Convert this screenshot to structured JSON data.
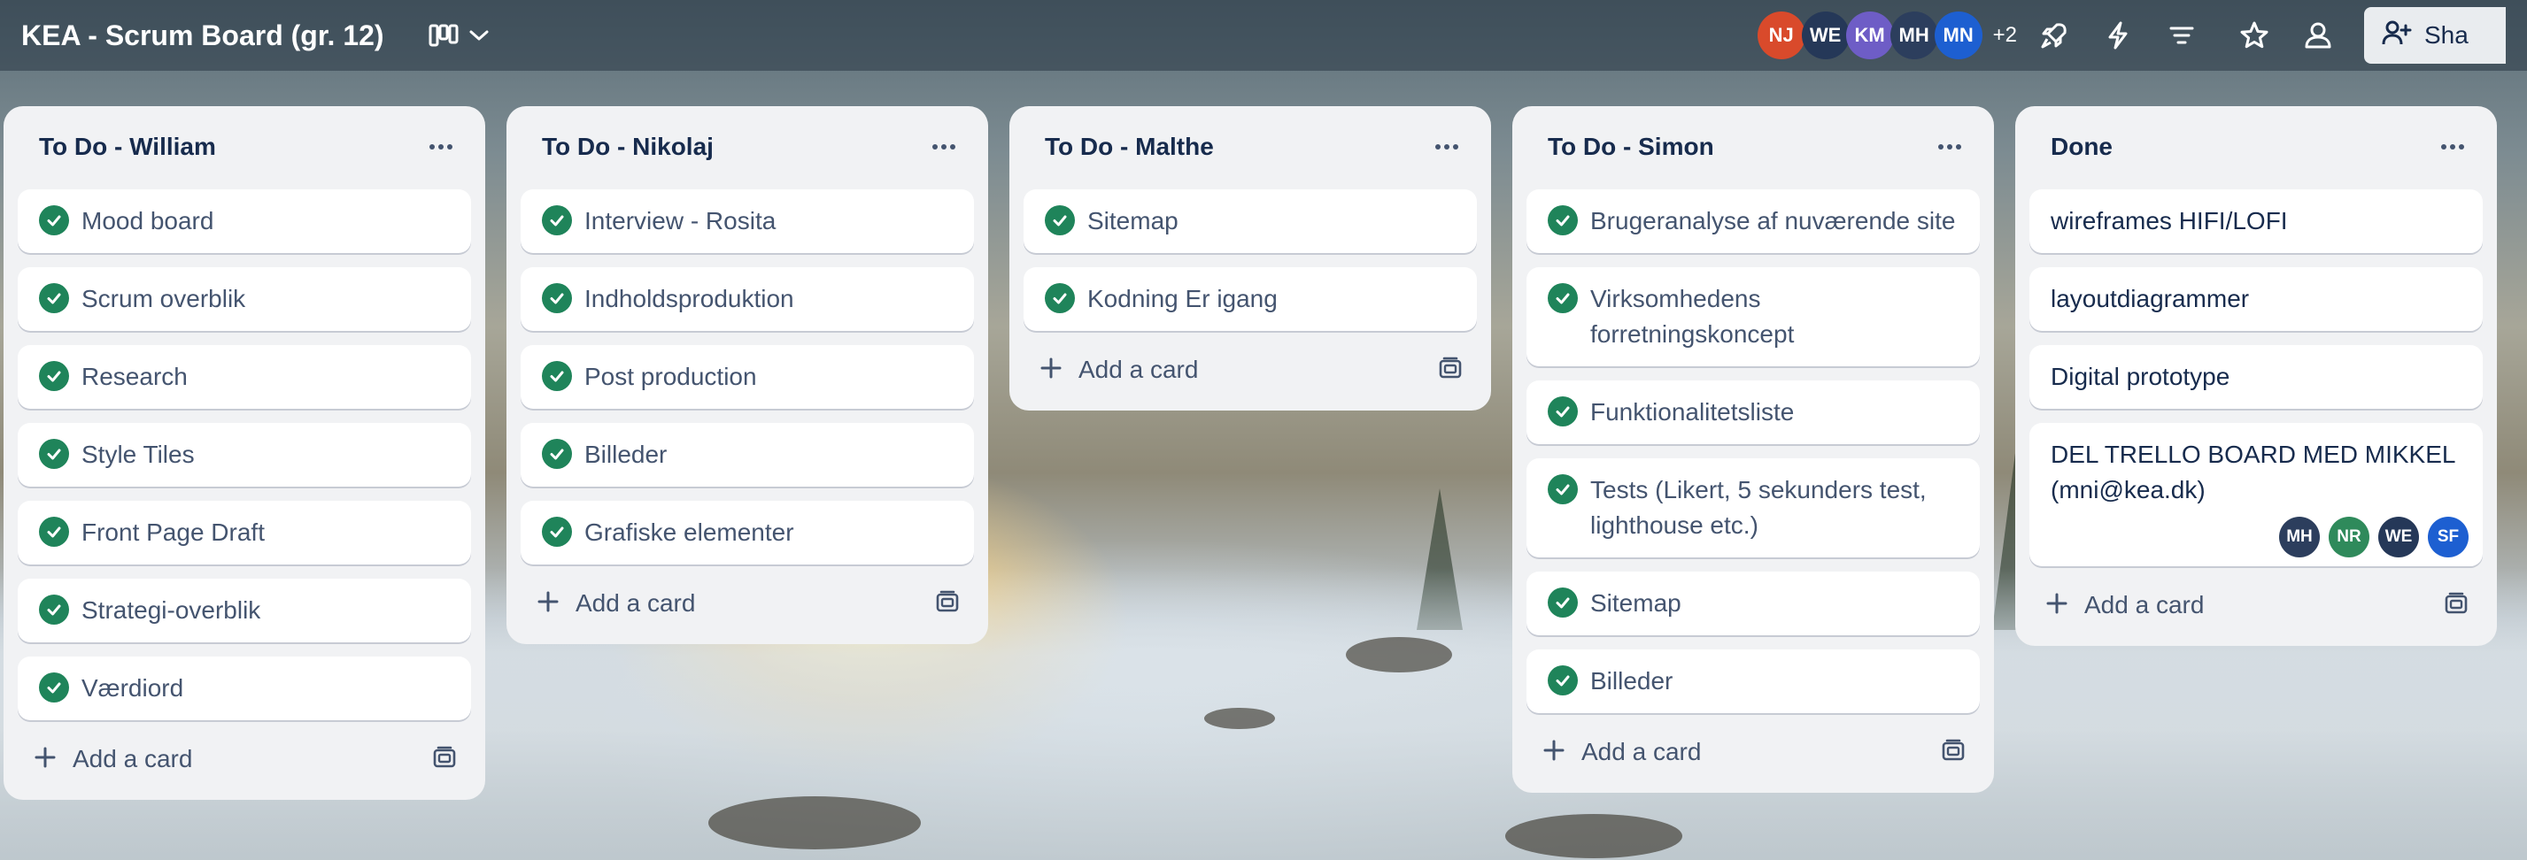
{
  "board": {
    "title": "KEA - Scrum Board (gr. 12)",
    "members": [
      {
        "initials": "NJ",
        "color": "#d94a2b"
      },
      {
        "initials": "WE",
        "color": "#253858"
      },
      {
        "initials": "KM",
        "color": "#6e5dc6"
      },
      {
        "initials": "MH",
        "color": "#2c3e5d"
      },
      {
        "initials": "MN",
        "color": "#1d5fd1"
      }
    ],
    "more_members": "+2",
    "share_label": "Sha",
    "icons": [
      "board-view-icon",
      "chevron-down-icon",
      "rocket-icon",
      "lightning-icon",
      "filter-icon",
      "star-icon",
      "people-icon",
      "add-person-icon"
    ]
  },
  "add_card_label": "Add a card",
  "lists": [
    {
      "title": "To Do - William",
      "cards": [
        {
          "text": "Mood board",
          "done": true
        },
        {
          "text": "Scrum overblik",
          "done": true
        },
        {
          "text": "Research",
          "done": true
        },
        {
          "text": "Style Tiles",
          "done": true
        },
        {
          "text": "Front Page Draft",
          "done": true
        },
        {
          "text": "Strategi-overblik",
          "done": true
        },
        {
          "text": "Værdiord",
          "done": true
        }
      ]
    },
    {
      "title": "To Do - Nikolaj",
      "cards": [
        {
          "text": "Interview - Rosita",
          "done": true
        },
        {
          "text": "Indholdsproduktion",
          "done": true
        },
        {
          "text": "Post production",
          "done": true
        },
        {
          "text": "Billeder",
          "done": true
        },
        {
          "text": "Grafiske elementer",
          "done": true
        }
      ]
    },
    {
      "title": "To Do - Malthe",
      "cards": [
        {
          "text": "Sitemap",
          "done": true
        },
        {
          "text": "Kodning Er igang",
          "done": true
        }
      ]
    },
    {
      "title": "To Do - Simon",
      "cards": [
        {
          "text": "Brugeranalyse af nuværende site",
          "done": true
        },
        {
          "text": "Virksomhedens forretningskoncept",
          "done": true
        },
        {
          "text": "Funktionalitetsliste",
          "done": true
        },
        {
          "text": "Tests (Likert, 5 sekunders test, lighthouse etc.)",
          "done": true
        },
        {
          "text": "Sitemap",
          "done": true
        },
        {
          "text": "Billeder",
          "done": true
        }
      ]
    },
    {
      "title": "Done",
      "cards": [
        {
          "text": "wireframes HIFI/LOFI",
          "done": false
        },
        {
          "text": "layoutdiagrammer",
          "done": false
        },
        {
          "text": "Digital prototype",
          "done": false
        },
        {
          "text": "DEL TRELLO BOARD MED MIKKEL (mni@kea.dk)",
          "done": false,
          "members": [
            {
              "initials": "MH",
              "color": "#2c3e5d"
            },
            {
              "initials": "NR",
              "color": "#2f8a5b"
            },
            {
              "initials": "WE",
              "color": "#253858"
            },
            {
              "initials": "SF",
              "color": "#1d5fd1"
            }
          ]
        }
      ]
    }
  ]
}
